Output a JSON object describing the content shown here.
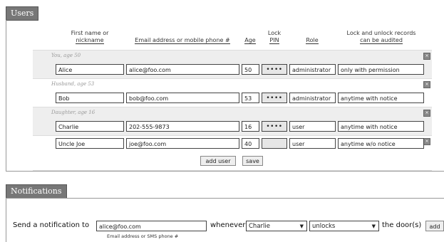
{
  "users_panel": {
    "title": "Users",
    "headers": {
      "first_name_l1": "First name or",
      "first_name_l2": "nickname",
      "email": "Email address or mobile phone #",
      "age": "Age",
      "lock_pin_l1": "Lock",
      "lock_pin_l2": "PIN",
      "role": "Role",
      "audit_l1": "Lock and unlock records",
      "audit_l2": "can be audited"
    },
    "rows": [
      {
        "note": "You, age 50",
        "name": "Alice",
        "email": "alice@foo.com",
        "age": "50",
        "pin": "••••",
        "role": "administrator",
        "audit": "only with permission",
        "remove": "×"
      },
      {
        "note": "Husband, age 53",
        "name": "Bob",
        "email": "bob@foo.com",
        "age": "53",
        "pin": "••••",
        "role": "administrator",
        "audit": "anytime with notice",
        "remove": "×"
      },
      {
        "note": "Daughter, age 16",
        "name": "Charlie",
        "email": "202-555-9873",
        "age": "16",
        "pin": "••••",
        "role": "user",
        "audit": "anytime with notice",
        "remove": "×"
      },
      {
        "note": "",
        "name": "Uncle Joe",
        "email": "joe@foo.com",
        "age": "40",
        "pin": "",
        "role": "user",
        "audit": "anytime w/o notice",
        "remove": "×"
      }
    ],
    "add_user_label": "add user",
    "save_label": "save"
  },
  "notifications_panel": {
    "title": "Notifications",
    "send_label": "Send a notification to",
    "recipient_value": "alice@foo.com",
    "recipient_hint": "Email address or SMS phone #",
    "whenever_label": "whenever",
    "person_selected": "Charlie",
    "action_selected": "unlocks",
    "door_label": "the door(s)",
    "add_label": "add"
  },
  "icons": {
    "dropdown": "chevron-down-icon",
    "remove": "close-icon"
  }
}
